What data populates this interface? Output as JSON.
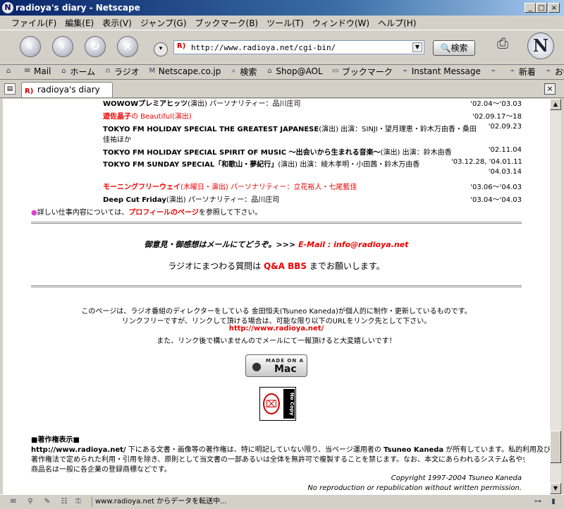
{
  "window": {
    "title": "radioya's diary - Netscape",
    "min": "_",
    "max": "□",
    "close": "×"
  },
  "menu": [
    "ファイル(F)",
    "編集(E)",
    "表示(V)",
    "ジャンプ(G)",
    "ブックマーク(B)",
    "ツール(T)",
    "ウィンドウ(W)",
    "ヘルプ(H)"
  ],
  "nav": {
    "url": "http://www.radioya.net/cgi-bin/",
    "search_label": "検索",
    "back": "‹",
    "forward": "›",
    "reload": "↻",
    "stop": "×"
  },
  "personal_toolbar": [
    {
      "icon": "home-menu-icon",
      "label": ""
    },
    {
      "icon": "mail-icon",
      "label": "Mail"
    },
    {
      "icon": "home-icon",
      "label": "ホーム"
    },
    {
      "icon": "radio-icon",
      "label": "ラジオ"
    },
    {
      "icon": "my-icon",
      "label": "Netscape.co.jp"
    },
    {
      "icon": "search-icon",
      "label": "検索"
    },
    {
      "icon": "shop-icon",
      "label": "Shop@AOL"
    },
    {
      "icon": "folder-icon",
      "label": "ブックマーク"
    },
    {
      "icon": "link-icon",
      "label": "Instant Message"
    },
    {
      "icon": "link-icon",
      "label": ""
    },
    {
      "icon": "link-icon",
      "label": "新着"
    },
    {
      "icon": "link-icon",
      "label": "お勧め"
    }
  ],
  "tab": {
    "title": "radioya's diary",
    "close": "×"
  },
  "works": [
    {
      "head": "WOWOWプレミアヒッツ",
      "rest": "(演出) パーソナリティー：品川庄司",
      "date": "'02.04～'03.03",
      "red": false
    },
    {
      "head": "遊佐晶子",
      "rest": "の Beautiful(演出)",
      "date": "'02.09.17～18",
      "red": true
    },
    {
      "head": "TOKYO FM HOLIDAY SPECIAL THE GREATEST JAPANESE",
      "rest": "(演出) 出演：SINJI・望月理恵・鈴木万由香・桑田",
      "date": "'02.09.23",
      "red": false
    },
    {
      "head": "",
      "rest": "佳祐ほか",
      "date": "",
      "red": false
    },
    {
      "head": "TOKYO FM HOLIDAY SPECIAL SPIRIT OF MUSIC ～出会いから生まれる音楽～",
      "rest": "(演出) 出演：鈴木由香",
      "date": "'02.11.04",
      "red": false
    },
    {
      "head": "TOKYO FM SUNDAY SPECIAL「和歌山・夢紀行」",
      "rest": "(演出) 出演：綾木孝明・小田茜・鈴木万由香",
      "date": "'03.12.28, '04.01.11",
      "red": false
    },
    {
      "head": "",
      "rest": "",
      "date": "'04.03.14",
      "red": false
    },
    {
      "head": "モーニングフリーウェイ",
      "rest": "(木曜日・演出) パーソナリティー：立花裕人・七尾藍佳",
      "date": "'03.06～'04.03",
      "red": true
    },
    {
      "head": "Deep Cut Friday",
      "rest": "(演出) パーソナリティー：品川庄司",
      "date": "'03.04～'04.03",
      "red": false
    }
  ],
  "profile_note": {
    "pre": "詳しい仕事内容については、",
    "link": "プロフィールのページ",
    "post": "を参照して下さい。"
  },
  "contact": {
    "text": "御意見・御感想はメールにてどうぞ。>>>",
    "email": "E-Mail : info@radioya.net"
  },
  "qa": {
    "pre": "ラジオにまつわる質問は",
    "link": "Q&A BBS",
    "post": "までお願いします。"
  },
  "about": {
    "line1": "このページは、ラジオ番組のディレクターをしている 金田恒夫(Tsuneo Kaneda)が個人的に制作・更新しているものです。",
    "line2": "リンクフリーですが、リンクして頂ける場合は、可能な限り以下のURLをリンク先として下さい。",
    "url": "http://www.radioya.net/",
    "line3": "また、リンク後で構いませんのでメールにて一報頂けると大変嬉しいです！"
  },
  "badges": {
    "made_on": "MADE ON A",
    "mac": "Mac",
    "nocopy": "No Copy"
  },
  "copyright_notice": {
    "title": "■著作権表示■",
    "site": "http://www.radioya.net/",
    "text1": "下にある文書・画像等の著作権は、特に明記していない限り、当ページ運用者の",
    "owner": "Tsuneo Kaneda",
    "text2": "が所有しています。私的利用及び",
    "line2": "著作権法で定められた利用・引用を除き、原則として当文書の一部あるいは全体を無許可で複製することを禁じます。なお、本文にあらわれるシステム名や会社名、",
    "line3": "商品名は一般に各企業の登録商標などです。",
    "copy1": "Copyright 1997-2004 Tsuneo Kaneda",
    "copy2": "No reproduction or republication without written permission."
  },
  "status": {
    "text": "www.radioya.net からデータを転送中..."
  }
}
